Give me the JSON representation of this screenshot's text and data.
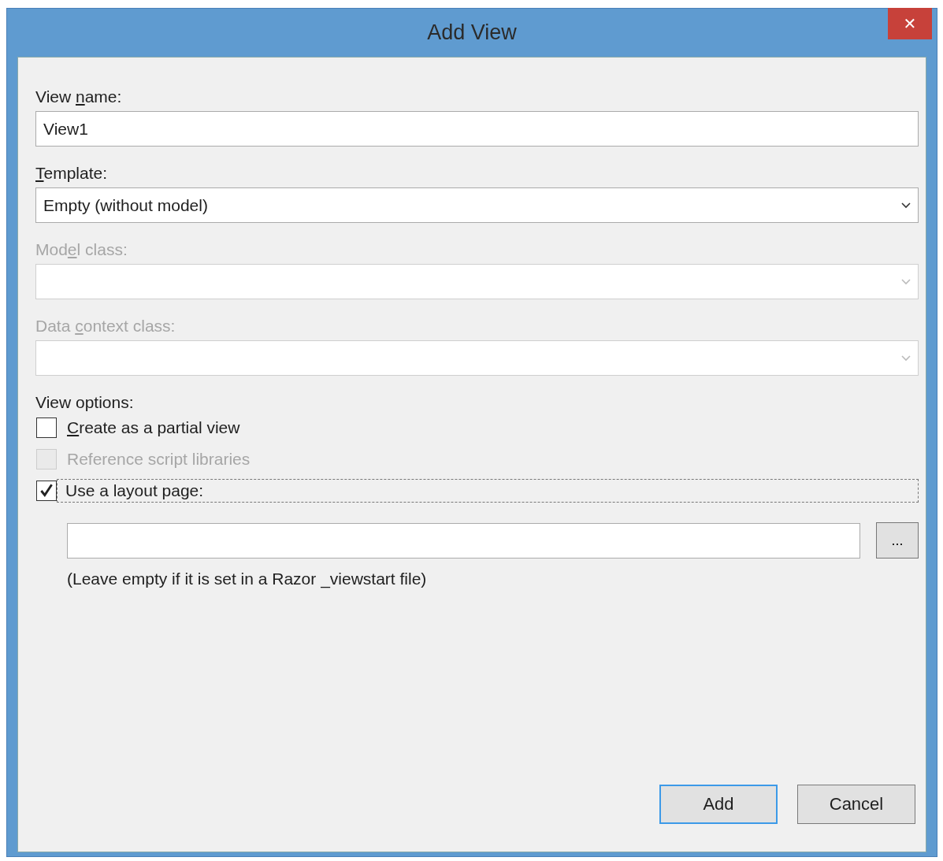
{
  "window": {
    "title": "Add View",
    "close_glyph": "✕"
  },
  "fields": [
    {
      "kind": "text",
      "label": {
        "before": "View ",
        "key": "n",
        "after": "ame:"
      },
      "value": "View1",
      "disabled": false
    },
    {
      "kind": "dropdown",
      "label": {
        "key": "T",
        "after": "emplate:"
      },
      "value": "Empty (without model)",
      "disabled": false
    },
    {
      "kind": "dropdown",
      "label": {
        "before": "Mod",
        "key": "e",
        "after": "l class:"
      },
      "disabled": true
    },
    {
      "kind": "dropdown",
      "label": {
        "before": "Data ",
        "key": "c",
        "after": "ontext class:"
      },
      "disabled": true
    }
  ],
  "view_options": {
    "heading": "View options:",
    "options": [
      {
        "label": {
          "key": "C",
          "after": "reate as a partial view"
        },
        "checked": false,
        "disabled": false,
        "focused": false
      },
      {
        "label": {
          "before": "Reference script libraries"
        },
        "checked": false,
        "disabled": true,
        "focused": false
      },
      {
        "label": {
          "before": "Use a layout page:"
        },
        "checked": true,
        "disabled": false,
        "focused": true
      }
    ]
  },
  "layout_page": {
    "browse_label": "...",
    "hint": "(Leave empty if it is set in a Razor _viewstart file)"
  },
  "buttons": [
    {
      "label": "Add",
      "default": true
    },
    {
      "label": "Cancel",
      "default": false
    }
  ]
}
